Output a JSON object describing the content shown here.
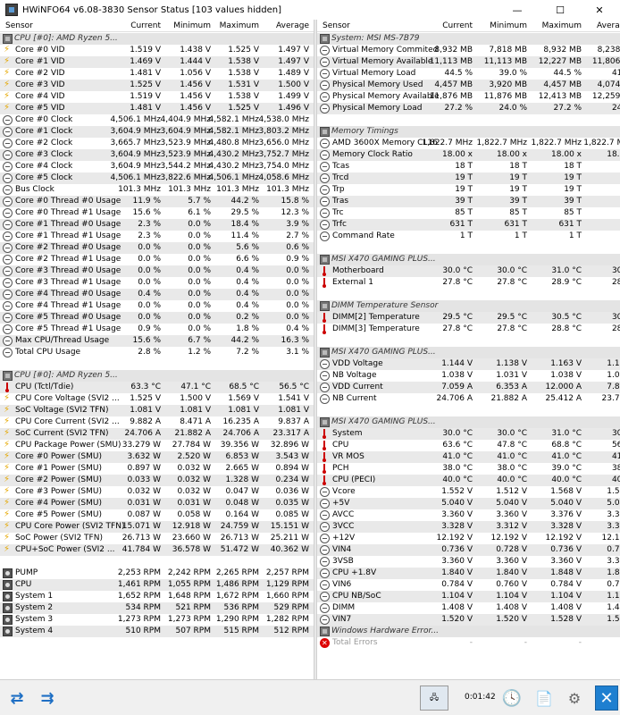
{
  "window": {
    "title": "HWiNFO64 v6.08-3830 Sensor Status [103 values hidden]",
    "min": "—",
    "max": "☐",
    "close": "✕"
  },
  "columns": {
    "sensor": "Sensor",
    "current": "Current",
    "minimum": "Minimum",
    "maximum": "Maximum",
    "average": "Average"
  },
  "left": [
    {
      "g": "CPU [#0]: AMD Ryzen 5..."
    },
    {
      "i": "bolt",
      "n": "Core #0 VID",
      "c": "1.519 V",
      "mi": "1.438 V",
      "ma": "1.525 V",
      "a": "1.497 V"
    },
    {
      "i": "bolt",
      "n": "Core #1 VID",
      "c": "1.469 V",
      "mi": "1.444 V",
      "ma": "1.538 V",
      "a": "1.497 V"
    },
    {
      "i": "bolt",
      "n": "Core #2 VID",
      "c": "1.481 V",
      "mi": "1.056 V",
      "ma": "1.538 V",
      "a": "1.489 V"
    },
    {
      "i": "bolt",
      "n": "Core #3 VID",
      "c": "1.525 V",
      "mi": "1.456 V",
      "ma": "1.531 V",
      "a": "1.500 V"
    },
    {
      "i": "bolt",
      "n": "Core #4 VID",
      "c": "1.519 V",
      "mi": "1.456 V",
      "ma": "1.538 V",
      "a": "1.499 V"
    },
    {
      "i": "bolt",
      "n": "Core #5 VID",
      "c": "1.481 V",
      "mi": "1.456 V",
      "ma": "1.525 V",
      "a": "1.496 V"
    },
    {
      "i": "clock",
      "n": "Core #0 Clock",
      "c": "4,506.1 MHz",
      "mi": "4,404.9 MHz",
      "ma": "4,582.1 MHz",
      "a": "4,538.0 MHz"
    },
    {
      "i": "clock",
      "n": "Core #1 Clock",
      "c": "3,604.9 MHz",
      "mi": "3,604.9 MHz",
      "ma": "4,582.1 MHz",
      "a": "3,803.2 MHz"
    },
    {
      "i": "clock",
      "n": "Core #2 Clock",
      "c": "3,665.7 MHz",
      "mi": "3,523.9 MHz",
      "ma": "4,480.8 MHz",
      "a": "3,656.0 MHz"
    },
    {
      "i": "clock",
      "n": "Core #3 Clock",
      "c": "3,604.9 MHz",
      "mi": "3,523.9 MHz",
      "ma": "4,430.2 MHz",
      "a": "3,752.7 MHz"
    },
    {
      "i": "clock",
      "n": "Core #4 Clock",
      "c": "3,604.9 MHz",
      "mi": "3,544.2 MHz",
      "ma": "4,430.2 MHz",
      "a": "3,754.0 MHz"
    },
    {
      "i": "clock",
      "n": "Core #5 Clock",
      "c": "4,506.1 MHz",
      "mi": "3,822.6 MHz",
      "ma": "4,506.1 MHz",
      "a": "4,058.6 MHz"
    },
    {
      "i": "clock",
      "n": "Bus Clock",
      "c": "101.3 MHz",
      "mi": "101.3 MHz",
      "ma": "101.3 MHz",
      "a": "101.3 MHz"
    },
    {
      "i": "clock",
      "n": "Core #0 Thread #0 Usage",
      "c": "11.9 %",
      "mi": "5.7 %",
      "ma": "44.2 %",
      "a": "15.8 %"
    },
    {
      "i": "clock",
      "n": "Core #0 Thread #1 Usage",
      "c": "15.6 %",
      "mi": "6.1 %",
      "ma": "29.5 %",
      "a": "12.3 %"
    },
    {
      "i": "clock",
      "n": "Core #1 Thread #0 Usage",
      "c": "2.3 %",
      "mi": "0.0 %",
      "ma": "18.4 %",
      "a": "3.9 %"
    },
    {
      "i": "clock",
      "n": "Core #1 Thread #1 Usage",
      "c": "2.3 %",
      "mi": "0.0 %",
      "ma": "11.4 %",
      "a": "2.7 %"
    },
    {
      "i": "clock",
      "n": "Core #2 Thread #0 Usage",
      "c": "0.0 %",
      "mi": "0.0 %",
      "ma": "5.6 %",
      "a": "0.6 %"
    },
    {
      "i": "clock",
      "n": "Core #2 Thread #1 Usage",
      "c": "0.0 %",
      "mi": "0.0 %",
      "ma": "6.6 %",
      "a": "0.9 %"
    },
    {
      "i": "clock",
      "n": "Core #3 Thread #0 Usage",
      "c": "0.0 %",
      "mi": "0.0 %",
      "ma": "0.4 %",
      "a": "0.0 %"
    },
    {
      "i": "clock",
      "n": "Core #3 Thread #1 Usage",
      "c": "0.0 %",
      "mi": "0.0 %",
      "ma": "0.4 %",
      "a": "0.0 %"
    },
    {
      "i": "clock",
      "n": "Core #4 Thread #0 Usage",
      "c": "0.4 %",
      "mi": "0.0 %",
      "ma": "0.4 %",
      "a": "0.0 %"
    },
    {
      "i": "clock",
      "n": "Core #4 Thread #1 Usage",
      "c": "0.0 %",
      "mi": "0.0 %",
      "ma": "0.4 %",
      "a": "0.0 %"
    },
    {
      "i": "clock",
      "n": "Core #5 Thread #0 Usage",
      "c": "0.0 %",
      "mi": "0.0 %",
      "ma": "0.2 %",
      "a": "0.0 %"
    },
    {
      "i": "clock",
      "n": "Core #5 Thread #1 Usage",
      "c": "0.9 %",
      "mi": "0.0 %",
      "ma": "1.8 %",
      "a": "0.4 %"
    },
    {
      "i": "clock",
      "n": "Max CPU/Thread Usage",
      "c": "15.6 %",
      "mi": "6.7 %",
      "ma": "44.2 %",
      "a": "16.3 %"
    },
    {
      "i": "clock",
      "n": "Total CPU Usage",
      "c": "2.8 %",
      "mi": "1.2 %",
      "ma": "7.2 %",
      "a": "3.1 %"
    },
    {
      "sp": 1
    },
    {
      "g": "CPU [#0]: AMD Ryzen 5..."
    },
    {
      "i": "therm",
      "n": "CPU (Tctl/Tdie)",
      "c": "63.3 °C",
      "mi": "47.1 °C",
      "ma": "68.5 °C",
      "a": "56.5 °C"
    },
    {
      "i": "bolt",
      "n": "CPU Core Voltage (SVI2 ...",
      "c": "1.525 V",
      "mi": "1.500 V",
      "ma": "1.569 V",
      "a": "1.541 V"
    },
    {
      "i": "bolt",
      "n": "SoC Voltage (SVI2 TFN)",
      "c": "1.081 V",
      "mi": "1.081 V",
      "ma": "1.081 V",
      "a": "1.081 V"
    },
    {
      "i": "bolt",
      "n": "CPU Core Current (SVI2 ...",
      "c": "9.882 A",
      "mi": "8.471 A",
      "ma": "16.235 A",
      "a": "9.837 A"
    },
    {
      "i": "bolt",
      "n": "SoC Current (SVI2 TFN)",
      "c": "24.706 A",
      "mi": "21.882 A",
      "ma": "24.706 A",
      "a": "23.317 A"
    },
    {
      "i": "bolt",
      "n": "CPU Package Power (SMU)",
      "c": "33.279 W",
      "mi": "27.784 W",
      "ma": "39.356 W",
      "a": "32.896 W"
    },
    {
      "i": "bolt",
      "n": "Core #0 Power (SMU)",
      "c": "3.632 W",
      "mi": "2.520 W",
      "ma": "6.853 W",
      "a": "3.543 W"
    },
    {
      "i": "bolt",
      "n": "Core #1 Power (SMU)",
      "c": "0.897 W",
      "mi": "0.032 W",
      "ma": "2.665 W",
      "a": "0.894 W"
    },
    {
      "i": "bolt",
      "n": "Core #2 Power (SMU)",
      "c": "0.033 W",
      "mi": "0.032 W",
      "ma": "1.328 W",
      "a": "0.234 W"
    },
    {
      "i": "bolt",
      "n": "Core #3 Power (SMU)",
      "c": "0.032 W",
      "mi": "0.032 W",
      "ma": "0.047 W",
      "a": "0.036 W"
    },
    {
      "i": "bolt",
      "n": "Core #4 Power (SMU)",
      "c": "0.031 W",
      "mi": "0.031 W",
      "ma": "0.048 W",
      "a": "0.035 W"
    },
    {
      "i": "bolt",
      "n": "Core #5 Power (SMU)",
      "c": "0.087 W",
      "mi": "0.058 W",
      "ma": "0.164 W",
      "a": "0.085 W"
    },
    {
      "i": "bolt",
      "n": "CPU Core Power (SVI2 TFN)",
      "c": "15.071 W",
      "mi": "12.918 W",
      "ma": "24.759 W",
      "a": "15.151 W"
    },
    {
      "i": "bolt",
      "n": "SoC Power (SVI2 TFN)",
      "c": "26.713 W",
      "mi": "23.660 W",
      "ma": "26.713 W",
      "a": "25.211 W"
    },
    {
      "i": "bolt",
      "n": "CPU+SoC Power (SVI2 ...",
      "c": "41.784 W",
      "mi": "36.578 W",
      "ma": "51.472 W",
      "a": "40.362 W"
    },
    {
      "sp": 1
    },
    {
      "i": "fan",
      "n": "PUMP",
      "c": "2,253 RPM",
      "mi": "2,242 RPM",
      "ma": "2,265 RPM",
      "a": "2,257 RPM"
    },
    {
      "i": "fan",
      "n": "CPU",
      "c": "1,461 RPM",
      "mi": "1,055 RPM",
      "ma": "1,486 RPM",
      "a": "1,129 RPM"
    },
    {
      "i": "fan",
      "n": "System 1",
      "c": "1,652 RPM",
      "mi": "1,648 RPM",
      "ma": "1,672 RPM",
      "a": "1,660 RPM"
    },
    {
      "i": "fan",
      "n": "System 2",
      "c": "534 RPM",
      "mi": "521 RPM",
      "ma": "536 RPM",
      "a": "529 RPM"
    },
    {
      "i": "fan",
      "n": "System 3",
      "c": "1,273 RPM",
      "mi": "1,273 RPM",
      "ma": "1,290 RPM",
      "a": "1,282 RPM"
    },
    {
      "i": "fan",
      "n": "System 4",
      "c": "510 RPM",
      "mi": "507 RPM",
      "ma": "515 RPM",
      "a": "512 RPM"
    }
  ],
  "right": [
    {
      "g": "System: MSI MS-7B79"
    },
    {
      "i": "clock",
      "n": "Virtual Memory Commited",
      "c": "8,932 MB",
      "mi": "7,818 MB",
      "ma": "8,932 MB",
      "a": "8,238 M"
    },
    {
      "i": "clock",
      "n": "Virtual Memory Available",
      "c": "11,113 MB",
      "mi": "11,113 MB",
      "ma": "12,227 MB",
      "a": "11,806 M"
    },
    {
      "i": "clock",
      "n": "Virtual Memory Load",
      "c": "44.5 %",
      "mi": "39.0 %",
      "ma": "44.5 %",
      "a": "41.0 "
    },
    {
      "i": "clock",
      "n": "Physical Memory Used",
      "c": "4,457 MB",
      "mi": "3,920 MB",
      "ma": "4,457 MB",
      "a": "4,074 M"
    },
    {
      "i": "clock",
      "n": "Physical Memory Available",
      "c": "11,876 MB",
      "mi": "11,876 MB",
      "ma": "12,413 MB",
      "a": "12,259 M"
    },
    {
      "i": "clock",
      "n": "Physical Memory Load",
      "c": "27.2 %",
      "mi": "24.0 %",
      "ma": "27.2 %",
      "a": "24.9 "
    },
    {
      "sp": 1
    },
    {
      "g": "Memory Timings"
    },
    {
      "i": "clock",
      "n": "AMD 3600X Memory CL16",
      "c": "1,822.7 MHz",
      "mi": "1,822.7 MHz",
      "ma": "1,822.7 MHz",
      "a": "1,822.7 MH"
    },
    {
      "i": "clock",
      "n": "Memory Clock Ratio",
      "c": "18.00 x",
      "mi": "18.00 x",
      "ma": "18.00 x",
      "a": "18.00"
    },
    {
      "i": "clock",
      "n": "Tcas",
      "c": "18 T",
      "mi": "18 T",
      "ma": "18 T",
      "a": ""
    },
    {
      "i": "clock",
      "n": "Trcd",
      "c": "19 T",
      "mi": "19 T",
      "ma": "19 T",
      "a": ""
    },
    {
      "i": "clock",
      "n": "Trp",
      "c": "19 T",
      "mi": "19 T",
      "ma": "19 T",
      "a": ""
    },
    {
      "i": "clock",
      "n": "Tras",
      "c": "39 T",
      "mi": "39 T",
      "ma": "39 T",
      "a": ""
    },
    {
      "i": "clock",
      "n": "Trc",
      "c": "85 T",
      "mi": "85 T",
      "ma": "85 T",
      "a": ""
    },
    {
      "i": "clock",
      "n": "Trfc",
      "c": "631 T",
      "mi": "631 T",
      "ma": "631 T",
      "a": ""
    },
    {
      "i": "clock",
      "n": "Command Rate",
      "c": "1 T",
      "mi": "1 T",
      "ma": "1 T",
      "a": ""
    },
    {
      "sp": 1
    },
    {
      "g": "MSI X470 GAMING PLUS..."
    },
    {
      "i": "therm",
      "n": "Motherboard",
      "c": "30.0 °C",
      "mi": "30.0 °C",
      "ma": "31.0 °C",
      "a": "30.5 "
    },
    {
      "i": "therm",
      "n": "External 1",
      "c": "27.8 °C",
      "mi": "27.8 °C",
      "ma": "28.9 °C",
      "a": "28.2 "
    },
    {
      "sp": 1
    },
    {
      "g": "DIMM Temperature Sensor"
    },
    {
      "i": "therm",
      "n": "DIMM[2] Temperature",
      "c": "29.5 °C",
      "mi": "29.5 °C",
      "ma": "30.5 °C",
      "a": "30.0 "
    },
    {
      "i": "therm",
      "n": "DIMM[3] Temperature",
      "c": "27.8 °C",
      "mi": "27.8 °C",
      "ma": "28.8 °C",
      "a": "28.2 "
    },
    {
      "sp": 1
    },
    {
      "g": "MSI X470 GAMING PLUS..."
    },
    {
      "i": "clock",
      "n": "VDD Voltage",
      "c": "1.144 V",
      "mi": "1.138 V",
      "ma": "1.163 V",
      "a": "1.150"
    },
    {
      "i": "clock",
      "n": "NB Voltage",
      "c": "1.038 V",
      "mi": "1.031 V",
      "ma": "1.038 V",
      "a": "1.036"
    },
    {
      "i": "clock",
      "n": "VDD Current",
      "c": "7.059 A",
      "mi": "6.353 A",
      "ma": "12.000 A",
      "a": "7.833"
    },
    {
      "i": "clock",
      "n": "NB Current",
      "c": "24.706 A",
      "mi": "21.882 A",
      "ma": "25.412 A",
      "a": "23.750"
    },
    {
      "sp": 1
    },
    {
      "g": "MSI X470 GAMING PLUS..."
    },
    {
      "i": "therm",
      "n": "System",
      "c": "30.0 °C",
      "mi": "30.0 °C",
      "ma": "31.0 °C",
      "a": "30.2 "
    },
    {
      "i": "therm",
      "n": "CPU",
      "c": "63.6 °C",
      "mi": "47.8 °C",
      "ma": "68.8 °C",
      "a": "56.8 "
    },
    {
      "i": "therm",
      "n": "VR MOS",
      "c": "41.0 °C",
      "mi": "41.0 °C",
      "ma": "41.0 °C",
      "a": "41.0 "
    },
    {
      "i": "therm",
      "n": "PCH",
      "c": "38.0 °C",
      "mi": "38.0 °C",
      "ma": "39.0 °C",
      "a": "38.3 "
    },
    {
      "i": "therm",
      "n": "CPU (PECI)",
      "c": "40.0 °C",
      "mi": "40.0 °C",
      "ma": "40.0 °C",
      "a": "40.0 "
    },
    {
      "i": "clock",
      "n": "Vcore",
      "c": "1.552 V",
      "mi": "1.512 V",
      "ma": "1.568 V",
      "a": "1.550"
    },
    {
      "i": "clock",
      "n": "+5V",
      "c": "5.040 V",
      "mi": "5.040 V",
      "ma": "5.040 V",
      "a": "5.040"
    },
    {
      "i": "clock",
      "n": "AVCC",
      "c": "3.360 V",
      "mi": "3.360 V",
      "ma": "3.376 V",
      "a": "3.362"
    },
    {
      "i": "clock",
      "n": "3VCC",
      "c": "3.328 V",
      "mi": "3.312 V",
      "ma": "3.328 V",
      "a": "3.327"
    },
    {
      "i": "clock",
      "n": "+12V",
      "c": "12.192 V",
      "mi": "12.192 V",
      "ma": "12.192 V",
      "a": "12.192"
    },
    {
      "i": "clock",
      "n": "VIN4",
      "c": "0.736 V",
      "mi": "0.728 V",
      "ma": "0.736 V",
      "a": "0.731"
    },
    {
      "i": "clock",
      "n": "3VSB",
      "c": "3.360 V",
      "mi": "3.360 V",
      "ma": "3.360 V",
      "a": "3.360"
    },
    {
      "i": "clock",
      "n": "CPU +1.8V",
      "c": "1.840 V",
      "mi": "1.840 V",
      "ma": "1.848 V",
      "a": "1.842"
    },
    {
      "i": "clock",
      "n": "VIN6",
      "c": "0.784 V",
      "mi": "0.760 V",
      "ma": "0.784 V",
      "a": "0.773"
    },
    {
      "i": "clock",
      "n": "CPU NB/SoC",
      "c": "1.104 V",
      "mi": "1.104 V",
      "ma": "1.104 V",
      "a": "1.104"
    },
    {
      "i": "clock",
      "n": "DIMM",
      "c": "1.408 V",
      "mi": "1.408 V",
      "ma": "1.408 V",
      "a": "1.408"
    },
    {
      "i": "clock",
      "n": "VIN7",
      "c": "1.520 V",
      "mi": "1.520 V",
      "ma": "1.528 V",
      "a": "1.521"
    },
    {
      "g": "Windows Hardware Error..."
    },
    {
      "i": "err",
      "n": "Total Errors",
      "c": "-",
      "mi": "-",
      "ma": "-",
      "a": "-",
      "muted": true
    }
  ],
  "status": {
    "elapsed": "0:01:42"
  }
}
